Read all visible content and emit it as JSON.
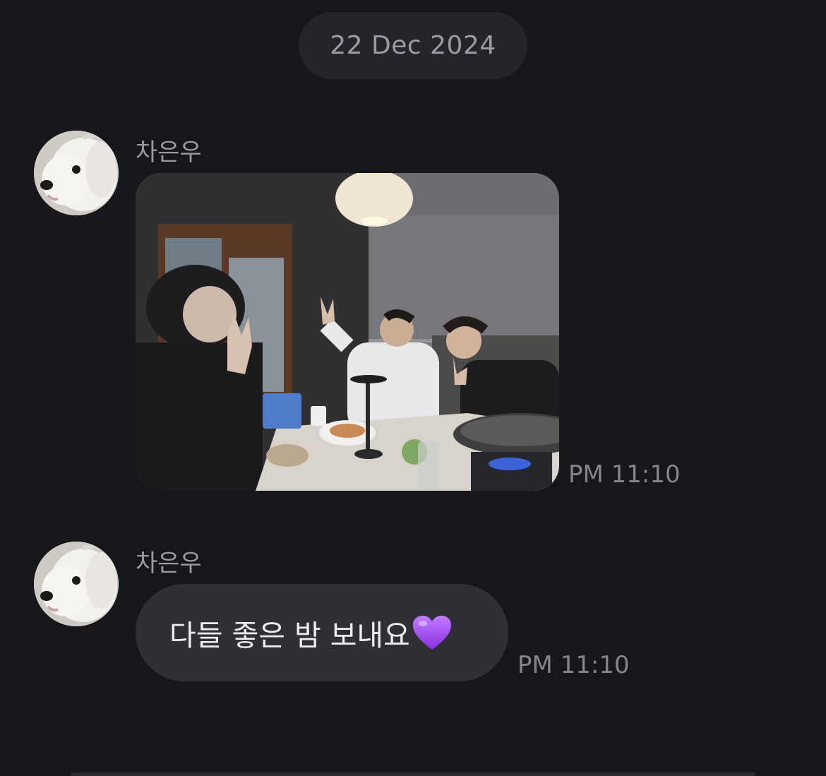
{
  "chat": {
    "date_separator": "22 Dec 2024",
    "messages": [
      {
        "sender": "차은우",
        "type": "photo",
        "avatar_icon": "dog-avatar-icon",
        "time": "PM 11:10"
      },
      {
        "sender": "차은우",
        "type": "text",
        "avatar_icon": "dog-avatar-icon",
        "text": "다들 좋은 밤 보내요",
        "emoji": "purple-heart-icon",
        "time": "PM 11:10"
      }
    ]
  },
  "colors": {
    "background": "#16171b",
    "bubble": "#2f3036",
    "date_pill": "#24252b",
    "heart": "#a14ef0"
  }
}
